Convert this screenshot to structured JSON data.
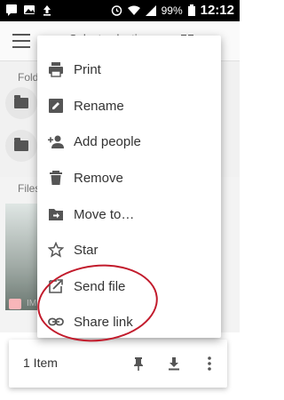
{
  "statusbar": {
    "battery": "99%",
    "time": "12:12"
  },
  "appbar": {
    "title": "Select selecti"
  },
  "sections": {
    "folders_label": "Fold",
    "files_label": "Files"
  },
  "thumb": {
    "caption": "IM"
  },
  "menu": {
    "items": [
      {
        "label": "Print",
        "icon": "print-icon"
      },
      {
        "label": "Rename",
        "icon": "rename-icon"
      },
      {
        "label": "Add people",
        "icon": "add-people-icon"
      },
      {
        "label": "Remove",
        "icon": "remove-icon"
      },
      {
        "label": "Move to…",
        "icon": "move-to-icon"
      },
      {
        "label": "Star",
        "icon": "star-icon"
      },
      {
        "label": "Send file",
        "icon": "send-file-icon"
      },
      {
        "label": "Share link",
        "icon": "share-link-icon"
      }
    ]
  },
  "bottombar": {
    "count": "1 Item"
  },
  "annotation": {
    "color": "#c21b2c"
  }
}
